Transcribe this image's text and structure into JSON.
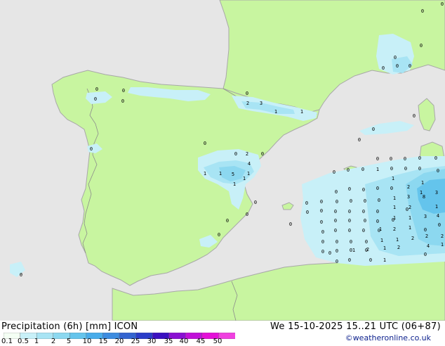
{
  "legend": {
    "product": "Precipitation (6h) [mm] ICON",
    "valid": "We 15-10-2025 15..21 UTC (06+87)",
    "credit": "©weatheronline.co.uk",
    "scale_values": [
      "0.1",
      "0.5",
      "1",
      "2",
      "5",
      "10",
      "15",
      "20",
      "25",
      "30",
      "35",
      "40",
      "45",
      "50"
    ],
    "scale_colors": [
      "#f4fff4",
      "#c8f0f8",
      "#a8e4f4",
      "#8cd8f0",
      "#64c4ec",
      "#48acea",
      "#3c8ce0",
      "#3464d0",
      "#2a3cc8",
      "#3a10c0",
      "#8a10d2",
      "#c010d8",
      "#e410d8",
      "#f040e0"
    ]
  },
  "map": {
    "colors": {
      "sea": "#e6e6e6",
      "land": "#c8f5a0",
      "coast": "#a8a8a8",
      "border": "#8c8c8c",
      "p1": "#c8f0f8",
      "p2": "#a8e4f4",
      "p3": "#8cd8f0",
      "p4": "#64c4ec",
      "p5": "#48acea"
    },
    "labels": [
      {
        "t": "0"
      },
      {
        "t": "0"
      },
      {
        "t": "0"
      },
      {
        "t": "0"
      },
      {
        "t": "0"
      },
      {
        "t": "0"
      },
      {
        "t": "0"
      },
      {
        "t": "0"
      },
      {
        "t": "0"
      },
      {
        "t": "0"
      },
      {
        "t": "0"
      },
      {
        "t": "0"
      },
      {
        "t": "0"
      },
      {
        "t": "0"
      },
      {
        "t": "0"
      },
      {
        "t": "0"
      },
      {
        "t": "2"
      },
      {
        "t": "3"
      },
      {
        "t": "1"
      },
      {
        "t": "1"
      },
      {
        "t": "0"
      },
      {
        "t": "0"
      },
      {
        "t": "2"
      },
      {
        "t": "0"
      },
      {
        "t": "4"
      },
      {
        "t": "1"
      },
      {
        "t": "1"
      },
      {
        "t": "5"
      },
      {
        "t": "1"
      },
      {
        "t": "1"
      },
      {
        "t": "0"
      },
      {
        "t": "0"
      },
      {
        "t": "0"
      },
      {
        "t": "0"
      },
      {
        "t": "0"
      },
      {
        "t": "0"
      },
      {
        "t": "0"
      },
      {
        "t": "0"
      },
      {
        "t": "0"
      },
      {
        "t": "0"
      },
      {
        "t": "0"
      },
      {
        "t": "0"
      },
      {
        "t": "0"
      },
      {
        "t": "1"
      },
      {
        "t": "0"
      },
      {
        "t": "0"
      },
      {
        "t": "0"
      },
      {
        "t": "0"
      },
      {
        "t": "1"
      },
      {
        "t": "2"
      },
      {
        "t": "1"
      },
      {
        "t": "0"
      },
      {
        "t": "0"
      },
      {
        "t": "0"
      },
      {
        "t": "0"
      },
      {
        "t": "0"
      },
      {
        "t": "1"
      },
      {
        "t": "3"
      },
      {
        "t": "0"
      },
      {
        "t": "0"
      },
      {
        "t": "0"
      },
      {
        "t": "0"
      },
      {
        "t": "0"
      },
      {
        "t": "0"
      },
      {
        "t": "1"
      },
      {
        "t": "3"
      },
      {
        "t": "0"
      },
      {
        "t": "0"
      },
      {
        "t": "0"
      },
      {
        "t": "0"
      },
      {
        "t": "0"
      },
      {
        "t": "0"
      },
      {
        "t": "0"
      },
      {
        "t": "1"
      },
      {
        "t": "2"
      },
      {
        "t": "8"
      },
      {
        "t": "1"
      },
      {
        "t": "0"
      },
      {
        "t": "0"
      },
      {
        "t": "0"
      },
      {
        "t": "0"
      },
      {
        "t": "0"
      },
      {
        "t": "0"
      },
      {
        "t": "1"
      },
      {
        "t": "1"
      },
      {
        "t": "3"
      },
      {
        "t": "4"
      },
      {
        "t": "0"
      },
      {
        "t": "0"
      },
      {
        "t": "0"
      },
      {
        "t": "0"
      },
      {
        "t": "0"
      },
      {
        "t": "1"
      },
      {
        "t": "2"
      },
      {
        "t": "1"
      },
      {
        "t": "0"
      },
      {
        "t": "0"
      },
      {
        "t": "0"
      },
      {
        "t": "0"
      },
      {
        "t": "1"
      },
      {
        "t": "1"
      },
      {
        "t": "2"
      },
      {
        "t": "2"
      },
      {
        "t": "2"
      },
      {
        "t": "0"
      },
      {
        "t": "1"
      },
      {
        "t": "2"
      },
      {
        "t": "1"
      },
      {
        "t": "2"
      },
      {
        "t": "4"
      },
      {
        "t": "1"
      },
      {
        "t": "1"
      },
      {
        "t": "0"
      },
      {
        "t": "1"
      },
      {
        "t": "0"
      },
      {
        "t": "0"
      },
      {
        "t": "0"
      },
      {
        "t": "0"
      },
      {
        "t": "0"
      },
      {
        "t": "0"
      },
      {
        "t": "0"
      },
      {
        "t": "0"
      },
      {
        "t": "0"
      },
      {
        "t": "0"
      },
      {
        "t": "0"
      },
      {
        "t": "0"
      },
      {
        "t": "0"
      },
      {
        "t": "0"
      },
      {
        "t": "0"
      },
      {
        "t": "0"
      },
      {
        "t": "0"
      },
      {
        "t": "1"
      }
    ]
  }
}
